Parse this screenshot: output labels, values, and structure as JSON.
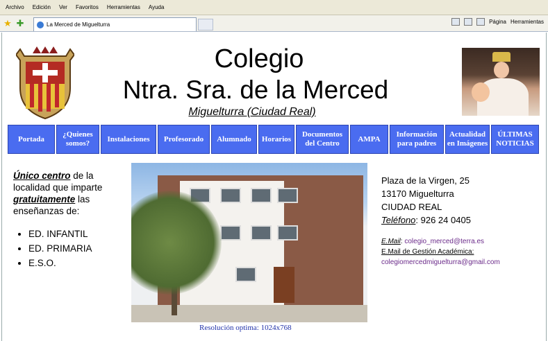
{
  "menu": [
    "Archivo",
    "Edición",
    "Ver",
    "Favoritos",
    "Herramientas",
    "Ayuda"
  ],
  "tab": {
    "title": "La Merced de Miguelturra"
  },
  "toolbar_right": {
    "pagina": "Página",
    "herramientas": "Herramientas"
  },
  "header": {
    "title1": "Colegio",
    "title2": "Ntra. Sra. de la Merced",
    "subtitle": "Miguelturra (Ciudad Real)"
  },
  "nav": [
    {
      "label": "Portada"
    },
    {
      "label": "¿Quienes somos?"
    },
    {
      "label": "Instalaciones"
    },
    {
      "label": "Profesorado"
    },
    {
      "label": "Alumnado"
    },
    {
      "label": "Horarios"
    },
    {
      "label": "Documentos del Centro"
    },
    {
      "label": "AMPA"
    },
    {
      "label": "Información para padres"
    },
    {
      "label": "Actualidad en Imágenes"
    },
    {
      "label": "ÚLTIMAS NOTICIAS"
    }
  ],
  "left": {
    "p1a": "Único centro",
    "p1b": " de la localidad que imparte ",
    "p1c": "gratuitamente",
    "p1d": " las enseñanzas de:",
    "items": [
      "ED. INFANTIL",
      "ED. PRIMARIA",
      "E.S.O."
    ]
  },
  "footer": {
    "resolution": "Resolución optima: 1024x768"
  },
  "contact": {
    "address": "Plaza de la Virgen, 25",
    "city": "13170 Miguelturra",
    "province": "CIUDAD REAL",
    "tel_label": "Teléfono",
    "tel": ": 926 24 0405",
    "email_label": "E.Mail",
    "email": "colegio_merced@terra.es",
    "gestion_label": "E.Mail de Gestión Académica:",
    "gestion_email": "colegiomercedmiguelturra@gmail.com"
  }
}
